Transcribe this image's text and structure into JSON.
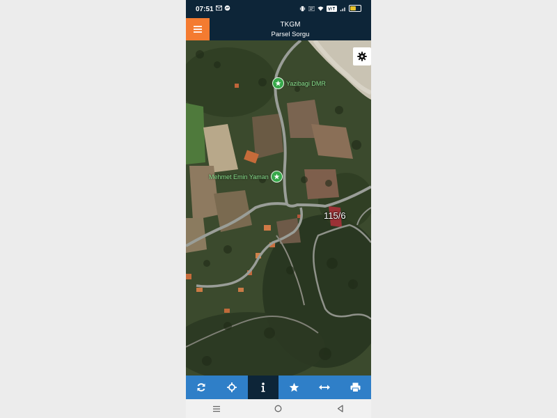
{
  "status_bar": {
    "time": "07:51",
    "icons": [
      "gmail-icon",
      "messenger-icon",
      "vibrate-icon",
      "data-speed-icon",
      "wifi-icon",
      "volte-icon",
      "signal-icon",
      "battery-icon"
    ],
    "battery_level": 0.55,
    "battery_color": "#e8c22a"
  },
  "header": {
    "title": "TKGM",
    "subtitle": "Parsel Sorgu",
    "menu_color": "#f47b30",
    "background": "#0d2538"
  },
  "map": {
    "pois": [
      {
        "label": "Yazibagi DMR",
        "icon": "poi-star-icon"
      },
      {
        "label": "Mehmet Emin Yaman",
        "icon": "poi-star-icon"
      }
    ],
    "parcel_label": "115/6",
    "parcel_color": "#b0303a"
  },
  "toolbar": {
    "background": "#2f7fc8",
    "active_background": "#0d2538",
    "tools": [
      {
        "name": "refresh-icon",
        "active": false
      },
      {
        "name": "locate-icon",
        "active": false
      },
      {
        "name": "info-icon",
        "active": true
      },
      {
        "name": "star-icon",
        "active": false
      },
      {
        "name": "measure-icon",
        "active": false
      },
      {
        "name": "print-icon",
        "active": false
      }
    ]
  },
  "nav_bar": {
    "items": [
      "recent-apps-icon",
      "home-icon",
      "back-icon"
    ]
  }
}
